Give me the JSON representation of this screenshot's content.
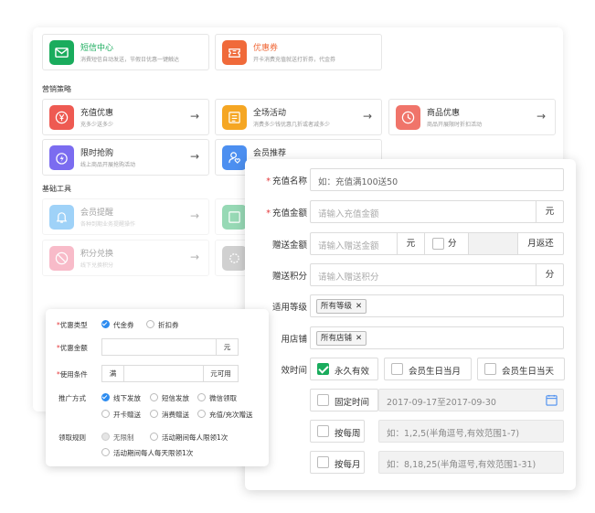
{
  "cards_top": [
    {
      "title": "短信中心",
      "desc": "消費短信自动发送，节假日优惠一键触达",
      "color": "#1aac5d",
      "icon": "envelope-icon"
    },
    {
      "title": "优惠券",
      "desc": "开卡消费充值就送打折券，代金券",
      "color": "#f06a3a",
      "icon": "ticket-icon"
    }
  ],
  "section_marketing": "营销策略",
  "cards_marketing": [
    {
      "title": "充值优惠",
      "desc": "充多少送多少",
      "color": "#ee5a52",
      "icon": "yen-icon"
    },
    {
      "title": "全场活动",
      "desc": "消费多少钱优惠几折或者减多少",
      "color": "#f5a623",
      "icon": "list-icon"
    },
    {
      "title": "商品优惠",
      "desc": "商品开展限时折扣活动",
      "color": "#f0746a",
      "icon": "clock-icon"
    },
    {
      "title": "限时抢购",
      "desc": "线上商品开展抢购活动",
      "color": "#7b6cf0",
      "icon": "flash-icon"
    },
    {
      "title": "会员推荐",
      "desc": "",
      "color": "#4c8ff0",
      "icon": "user-heart-icon"
    }
  ],
  "section_basic": "基础工具",
  "cards_basic": [
    {
      "title": "会员提醒",
      "desc": "各种到期业务提醒操作",
      "color": "#2d9cf0",
      "icon": "bell-icon"
    },
    {
      "title": "积分兑换",
      "desc": "线下兑换积分",
      "color": "#f06a8a",
      "icon": "no-icon"
    }
  ],
  "form": {
    "recharge_name_label": "充值名称",
    "recharge_name_placeholder": "如：充值满100送50",
    "recharge_amount_label": "充值金额",
    "recharge_amount_placeholder": "请输入充值金额",
    "recharge_amount_unit": "元",
    "gift_amount_label": "赠送金额",
    "gift_amount_placeholder": "请输入赠送金额",
    "gift_amount_unit": "元",
    "gift_split_label": "分",
    "gift_month_return": "月返还",
    "gift_points_label": "赠送积分",
    "gift_points_placeholder": "请输入赠送积分",
    "gift_points_unit": "分",
    "level_label": "适用等级",
    "level_tag": "所有等级",
    "store_label": "用店铺",
    "store_tag": "所有店铺",
    "validity_label": "效时间",
    "validity_options": [
      "永久有效",
      "会员生日当月",
      "会员生日当天"
    ],
    "fixed_time_label": "固定时间",
    "fixed_time_value": "2017-09-17至2017-09-30",
    "weekly_label": "按每周",
    "weekly_placeholder": "如：1,2,5(半角逗号,有效范围1-7)",
    "monthly_label": "按每月",
    "monthly_placeholder": "如：8,18,25(半角逗号,有效范围1-31)"
  },
  "left_form": {
    "coupon_type_label": "优惠类型",
    "coupon_type_options": [
      "代金券",
      "折扣券"
    ],
    "coupon_amount_label": "优惠金额",
    "coupon_amount_unit": "元",
    "condition_label": "使用条件",
    "condition_prefix": "满",
    "condition_suffix": "元可用",
    "promo_label": "推广方式",
    "promo_options": [
      "线下发放",
      "短信发放",
      "微信领取",
      "开卡赠送",
      "消费赠送",
      "充值/充次赠送"
    ],
    "claim_label": "领取规则",
    "claim_options": [
      "无限制",
      "活动期间每人限领1次",
      "活动期间每人每天限领1次"
    ]
  }
}
